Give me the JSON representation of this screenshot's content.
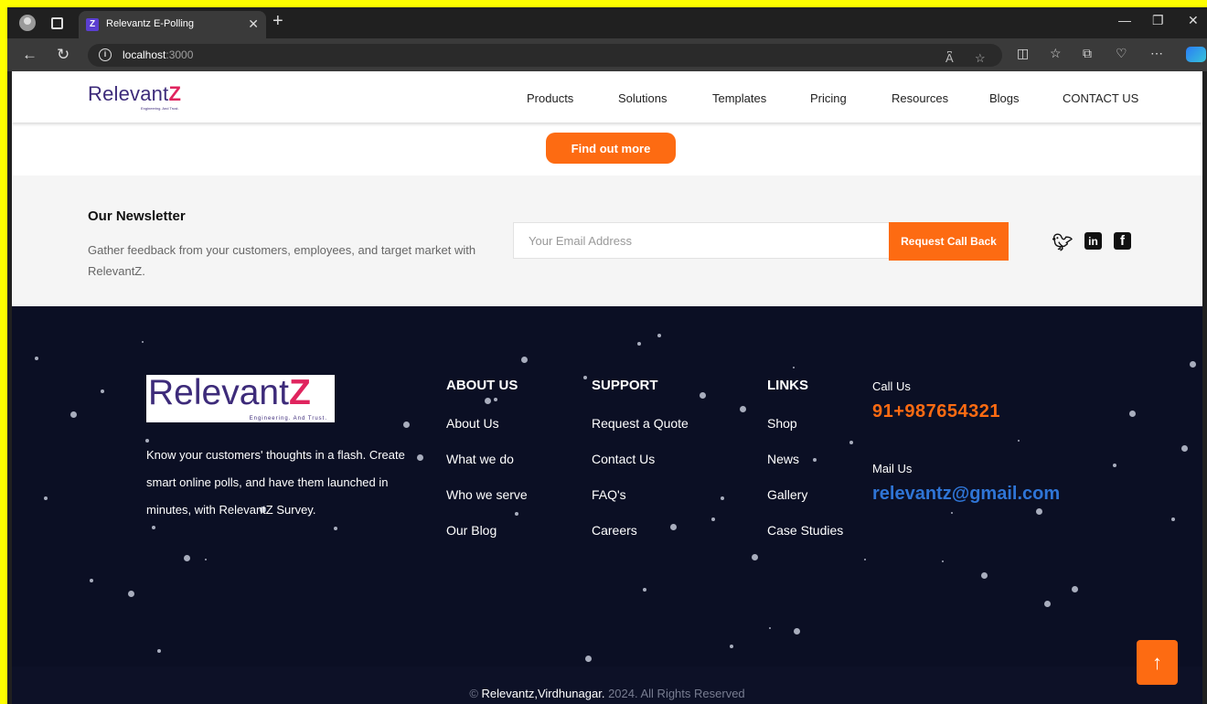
{
  "browser": {
    "tab_title": "Relevantz E-Polling",
    "favicon_letter": "Z",
    "url_host": "localhost",
    "url_port": ":3000"
  },
  "header": {
    "logo_text": "Relevant",
    "logo_z": "Z",
    "logo_tagline": "Engineering. And Trust.",
    "nav": [
      "Products",
      "Solutions",
      "Templates",
      "Pricing",
      "Resources",
      "Blogs",
      "CONTACT US"
    ]
  },
  "hero": {
    "button_label": "Find out more"
  },
  "newsletter": {
    "title": "Our Newsletter",
    "description": "Gather feedback from your customers, employees, and target market with RelevantZ.",
    "email_placeholder": "Your Email Address",
    "button_label": "Request Call Back",
    "social_icons": [
      "twitter-icon",
      "linkedin-icon",
      "facebook-icon"
    ]
  },
  "footer": {
    "logo_text": "Relevant",
    "logo_z": "Z",
    "logo_tagline": "Engineering. And Trust.",
    "about": "Know your customers' thoughts in a flash. Create smart online polls, and have them launched in minutes, with RelevantZ Survey.",
    "about_us": {
      "title": "ABOUT US",
      "links": [
        "About Us",
        "What we do",
        "Who we serve",
        "Our Blog"
      ]
    },
    "support": {
      "title": "SUPPORT",
      "links": [
        "Request a Quote",
        "Contact Us",
        "FAQ's",
        "Careers"
      ]
    },
    "links": {
      "title": "LINKS",
      "links": [
        "Shop",
        "News",
        "Gallery",
        "Case Studies"
      ]
    },
    "call_label": "Call Us",
    "phone": "91+987654321",
    "mail_label": "Mail Us",
    "email": "relevantz@gmail.com",
    "copyright_prefix": "© ",
    "copyright_company": "Relevantz,Virdhunagar.",
    "copyright_suffix": " 2024. All Rights Reserved"
  },
  "colors": {
    "accent": "#fd6b12",
    "footer_bg": "#0b0f24",
    "brand": "#3d2b7a",
    "link_blue": "#2f75d6"
  }
}
